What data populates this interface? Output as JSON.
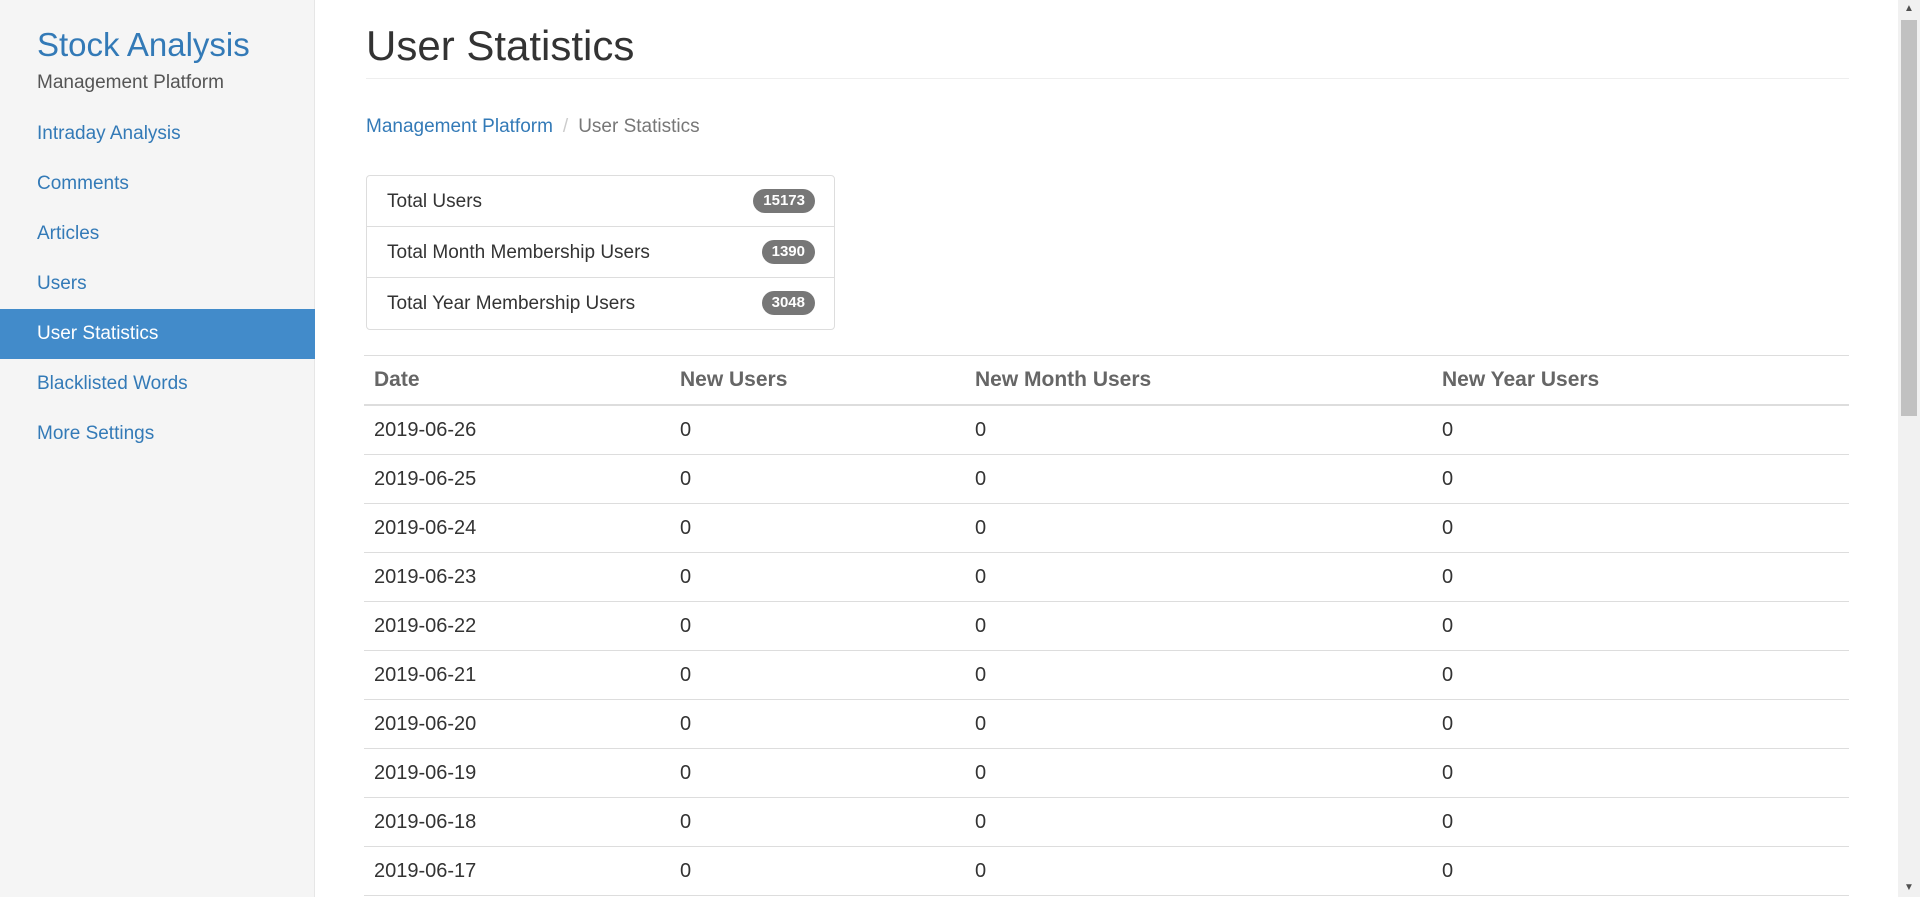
{
  "sidebar": {
    "brand_title": "Stock Analysis",
    "brand_subtitle": "Management Platform",
    "items": [
      {
        "label": "Intraday Analysis"
      },
      {
        "label": "Comments"
      },
      {
        "label": "Articles"
      },
      {
        "label": "Users"
      },
      {
        "label": "User Statistics"
      },
      {
        "label": "Blacklisted Words"
      },
      {
        "label": "More Settings"
      }
    ],
    "active_item": "User Statistics"
  },
  "main": {
    "title": "User Statistics",
    "breadcrumb": {
      "parent": "Management Platform",
      "separator": "/",
      "current": "User Statistics"
    },
    "summary": [
      {
        "label": "Total Users",
        "value": "15173"
      },
      {
        "label": "Total Month Membership Users",
        "value": "1390"
      },
      {
        "label": "Total Year Membership Users",
        "value": "3048"
      }
    ],
    "table": {
      "headers": [
        "Date",
        "New Users",
        "New Month Users",
        "New Year Users"
      ],
      "rows": [
        [
          "2019-06-26",
          "0",
          "0",
          "0"
        ],
        [
          "2019-06-25",
          "0",
          "0",
          "0"
        ],
        [
          "2019-06-24",
          "0",
          "0",
          "0"
        ],
        [
          "2019-06-23",
          "0",
          "0",
          "0"
        ],
        [
          "2019-06-22",
          "0",
          "0",
          "0"
        ],
        [
          "2019-06-21",
          "0",
          "0",
          "0"
        ],
        [
          "2019-06-20",
          "0",
          "0",
          "0"
        ],
        [
          "2019-06-19",
          "0",
          "0",
          "0"
        ],
        [
          "2019-06-18",
          "0",
          "0",
          "0"
        ],
        [
          "2019-06-17",
          "0",
          "0",
          "0"
        ]
      ]
    }
  },
  "colors": {
    "link": "#337ab7",
    "active_nav_bg": "#428bca",
    "badge_bg": "#777777"
  }
}
